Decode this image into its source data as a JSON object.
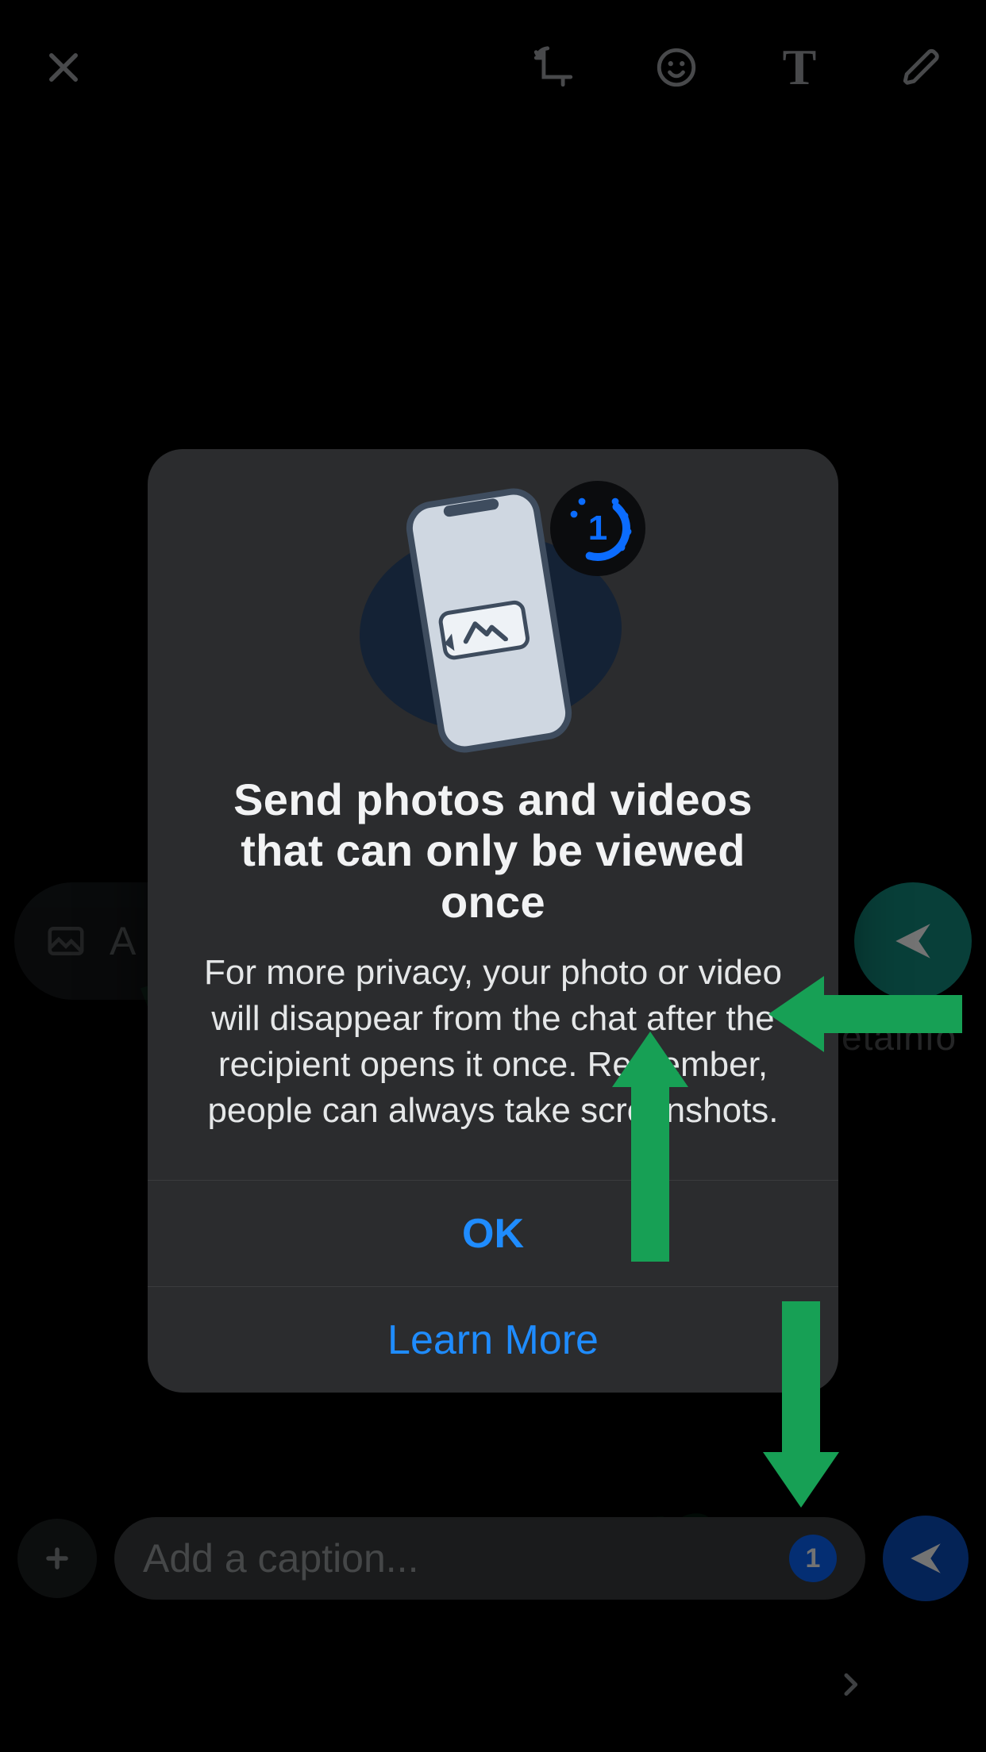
{
  "toolbar": {
    "close_label": "Close",
    "crop_label": "Crop & Rotate",
    "emoji_label": "Stickers & Emoji",
    "text_label": "Add Text",
    "text_glyph": "T",
    "draw_label": "Draw"
  },
  "bg_caption": {
    "placeholder_fragment": "A",
    "send_label": "Send"
  },
  "watermark_fragment": "etainfo",
  "dialog": {
    "title": "Send photos and videos that can only be viewed once",
    "body": "For more privacy, your photo or video will disappear from the chat after the recipient opens it once. Remember, people can always take screenshots.",
    "ok_label": "OK",
    "learn_more_label": "Learn More",
    "badge_glyph": "1"
  },
  "bottom": {
    "add_label": "Add media",
    "caption_placeholder": "Add a caption...",
    "view_once_value": "1",
    "send_label": "Send"
  },
  "watermark_text": "WABETAINFO",
  "colors": {
    "accent_blue": "#1f8cff",
    "green": "#17a055",
    "send_teal": "#128c7e"
  }
}
